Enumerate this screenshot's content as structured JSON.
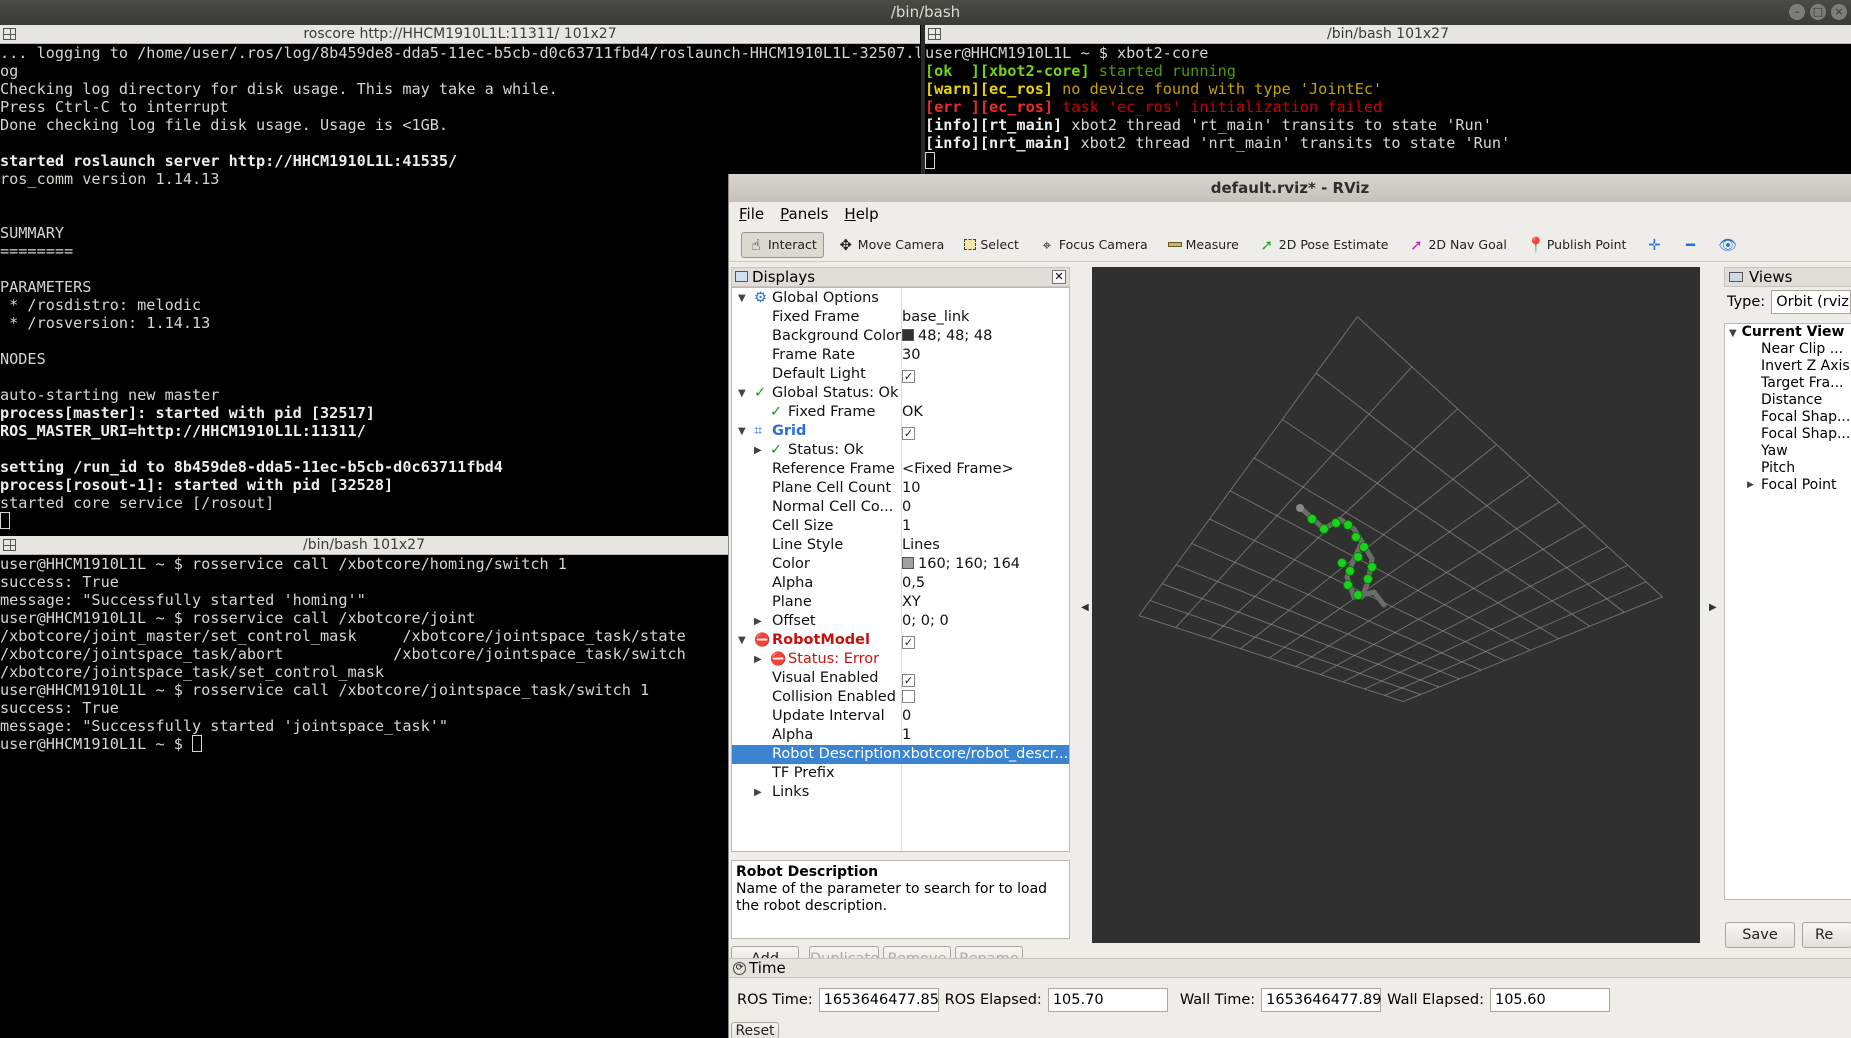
{
  "window_title": "/bin/bash",
  "terminal1": {
    "title": "roscore http://HHCM1910L1L:11311/ 101x27",
    "lines": [
      {
        "text": "... logging to /home/user/.ros/log/8b459de8-dda5-11ec-b5cb-d0c63711fbd4/roslaunch-HHCM1910L1L-32507.l",
        "style": "normal"
      },
      {
        "text": "og",
        "style": "normal"
      },
      {
        "text": "Checking log directory for disk usage. This may take a while.",
        "style": "normal"
      },
      {
        "text": "Press Ctrl-C to interrupt",
        "style": "normal"
      },
      {
        "text": "Done checking log file disk usage. Usage is <1GB.",
        "style": "normal"
      },
      {
        "text": "",
        "style": "normal"
      },
      {
        "text": "started roslaunch server http://HHCM1910L1L:41535/",
        "style": "bold"
      },
      {
        "text": "ros_comm version 1.14.13",
        "style": "normal"
      },
      {
        "text": "",
        "style": "normal"
      },
      {
        "text": "",
        "style": "normal"
      },
      {
        "text": "SUMMARY",
        "style": "normal"
      },
      {
        "text": "========",
        "style": "normal"
      },
      {
        "text": "",
        "style": "normal"
      },
      {
        "text": "PARAMETERS",
        "style": "normal"
      },
      {
        "text": " * /rosdistro: melodic",
        "style": "normal"
      },
      {
        "text": " * /rosversion: 1.14.13",
        "style": "normal"
      },
      {
        "text": "",
        "style": "normal"
      },
      {
        "text": "NODES",
        "style": "normal"
      },
      {
        "text": "",
        "style": "normal"
      },
      {
        "text": "auto-starting new master",
        "style": "normal"
      },
      {
        "text": "process[master]: started with pid [32517]",
        "style": "bold"
      },
      {
        "text": "ROS_MASTER_URI=http://HHCM1910L1L:11311/",
        "style": "bold"
      },
      {
        "text": "",
        "style": "normal"
      },
      {
        "text": "setting /run_id to 8b459de8-dda5-11ec-b5cb-d0c63711fbd4",
        "style": "bold"
      },
      {
        "text": "process[rosout-1]: started with pid [32528]",
        "style": "bold"
      },
      {
        "text": "started core service [/rosout]",
        "style": "normal"
      }
    ]
  },
  "terminal2": {
    "title": "/bin/bash 101x27",
    "lines": [
      {
        "segments": [
          {
            "text": "user@HHCM1910L1L ~ $ xbot2-core",
            "color": "default"
          }
        ]
      },
      {
        "segments": [
          {
            "text": "[ok  ][xbot2-core]",
            "color": "green-bold"
          },
          {
            "text": " started running",
            "color": "green"
          }
        ]
      },
      {
        "segments": [
          {
            "text": "[warn][ec_ros]",
            "color": "yellow-bold"
          },
          {
            "text": " no device found with type 'JointEc'",
            "color": "yellow"
          }
        ]
      },
      {
        "segments": [
          {
            "text": "[err ][ec_ros]",
            "color": "red-bold"
          },
          {
            "text": " task 'ec_ros' initialization failed",
            "color": "red"
          }
        ]
      },
      {
        "segments": [
          {
            "text": "[info][rt_main]",
            "color": "default-bold"
          },
          {
            "text": " xbot2 thread 'rt_main' transits to state 'Run'",
            "color": "default"
          }
        ]
      },
      {
        "segments": [
          {
            "text": "[info][nrt_main]",
            "color": "default-bold"
          },
          {
            "text": " xbot2 thread 'nrt_main' transits to state 'Run'",
            "color": "default"
          }
        ]
      }
    ]
  },
  "terminal3": {
    "title": "/bin/bash 101x27",
    "lines": [
      "user@HHCM1910L1L ~ $ rosservice call /xbotcore/homing/switch 1",
      "success: True",
      "message: \"Successfully started 'homing'\"",
      "user@HHCM1910L1L ~ $ rosservice call /xbotcore/joint",
      "/xbotcore/joint_master/set_control_mask     /xbotcore/jointspace_task/state",
      "/xbotcore/jointspace_task/abort            /xbotcore/jointspace_task/switch",
      "/xbotcore/jointspace_task/set_control_mask",
      "user@HHCM1910L1L ~ $ rosservice call /xbotcore/jointspace_task/switch 1",
      "success: True",
      "message: \"Successfully started 'jointspace_task'\"",
      "user@HHCM1910L1L ~ $ "
    ]
  },
  "rviz": {
    "title": "default.rviz* - RViz",
    "menu": [
      "File",
      "Panels",
      "Help"
    ],
    "tools": [
      {
        "label": "Interact",
        "icon": "hand-icon",
        "active": true
      },
      {
        "label": "Move Camera",
        "icon": "move-camera-icon",
        "active": false
      },
      {
        "label": "Select",
        "icon": "select-icon",
        "active": false
      },
      {
        "label": "Focus Camera",
        "icon": "focus-camera-icon",
        "active": false
      },
      {
        "label": "Measure",
        "icon": "measure-icon",
        "active": false
      },
      {
        "label": "2D Pose Estimate",
        "icon": "pose-estimate-icon",
        "active": false
      },
      {
        "label": "2D Nav Goal",
        "icon": "nav-goal-icon",
        "active": false
      },
      {
        "label": "Publish Point",
        "icon": "publish-point-icon",
        "active": false
      }
    ],
    "displays_title": "Displays",
    "display_rows": [
      {
        "label": "Global Options",
        "value": "",
        "depth": 0,
        "expand": "open",
        "icon": "globe"
      },
      {
        "label": "Fixed Frame",
        "value": "base_link",
        "depth": 1
      },
      {
        "label": "Background Color",
        "value": "48; 48; 48",
        "depth": 1,
        "swatch": "#303030"
      },
      {
        "label": "Frame Rate",
        "value": "30",
        "depth": 1
      },
      {
        "label": "Default Light",
        "value": "",
        "depth": 1,
        "check": true
      },
      {
        "label": "Global Status: Ok",
        "value": "",
        "depth": 0,
        "expand": "open",
        "icon": "ok"
      },
      {
        "label": "Fixed Frame",
        "value": "OK",
        "depth": 1,
        "icon": "ok"
      },
      {
        "label": "Grid",
        "value": "",
        "depth": 0,
        "expand": "open",
        "icon": "grid",
        "style": "blue",
        "check": true
      },
      {
        "label": "Status: Ok",
        "value": "",
        "depth": 1,
        "expand": "closed",
        "icon": "ok"
      },
      {
        "label": "Reference Frame",
        "value": "<Fixed Frame>",
        "depth": 1
      },
      {
        "label": "Plane Cell Count",
        "value": "10",
        "depth": 1
      },
      {
        "label": "Normal Cell Co...",
        "value": "0",
        "depth": 1
      },
      {
        "label": "Cell Size",
        "value": "1",
        "depth": 1
      },
      {
        "label": "Line Style",
        "value": "Lines",
        "depth": 1
      },
      {
        "label": "Color",
        "value": "160; 160; 164",
        "depth": 1,
        "swatch": "#a0a0a4"
      },
      {
        "label": "Alpha",
        "value": "0,5",
        "depth": 1
      },
      {
        "label": "Plane",
        "value": "XY",
        "depth": 1
      },
      {
        "label": "Offset",
        "value": "0; 0; 0",
        "depth": 1,
        "expand": "closed"
      },
      {
        "label": "RobotModel",
        "value": "",
        "depth": 0,
        "expand": "open",
        "icon": "error",
        "style": "red",
        "check": true
      },
      {
        "label": "Status: Error",
        "value": "",
        "depth": 1,
        "expand": "closed",
        "icon": "error",
        "style": "red"
      },
      {
        "label": "Visual Enabled",
        "value": "",
        "depth": 1,
        "check": true
      },
      {
        "label": "Collision Enabled",
        "value": "",
        "depth": 1,
        "check": false
      },
      {
        "label": "Update Interval",
        "value": "0",
        "depth": 1
      },
      {
        "label": "Alpha",
        "value": "1",
        "depth": 1
      },
      {
        "label": "Robot Description",
        "value": "xbotcore/robot_descr...",
        "depth": 1,
        "selected": true
      },
      {
        "label": "TF Prefix",
        "value": "",
        "depth": 1
      },
      {
        "label": "Links",
        "value": "",
        "depth": 1,
        "expand": "closed"
      }
    ],
    "description": {
      "title": "Robot Description",
      "text": "Name of the parameter to search for to load the robot description."
    },
    "display_buttons": [
      {
        "label": "Add",
        "enabled": true
      },
      {
        "label": "Duplicate",
        "enabled": false
      },
      {
        "label": "Remove",
        "enabled": false
      },
      {
        "label": "Rename",
        "enabled": false
      }
    ],
    "views": {
      "title": "Views",
      "type_label": "Type:",
      "type_value": "Orbit (rviz)",
      "current_view": "Current View",
      "items": [
        "Near Clip ...",
        "Invert Z Axis",
        "Target Fra...",
        "Distance",
        "Focal Shap...",
        "Focal Shap...",
        "Yaw",
        "Pitch",
        "Focal Point"
      ],
      "save_label": "Save",
      "reset_label": "Re"
    },
    "time": {
      "title": "Time",
      "ros_time_label": "ROS Time:",
      "ros_time": "1653646477.85",
      "ros_elapsed_label": "ROS Elapsed:",
      "ros_elapsed": "105.70",
      "wall_time_label": "Wall Time:",
      "wall_time": "1653646477.89",
      "wall_elapsed_label": "Wall Elapsed:",
      "wall_elapsed": "105.60",
      "reset_label": "Reset"
    },
    "viewport_background": "#303030",
    "grid_color": "#a0a0a4"
  }
}
